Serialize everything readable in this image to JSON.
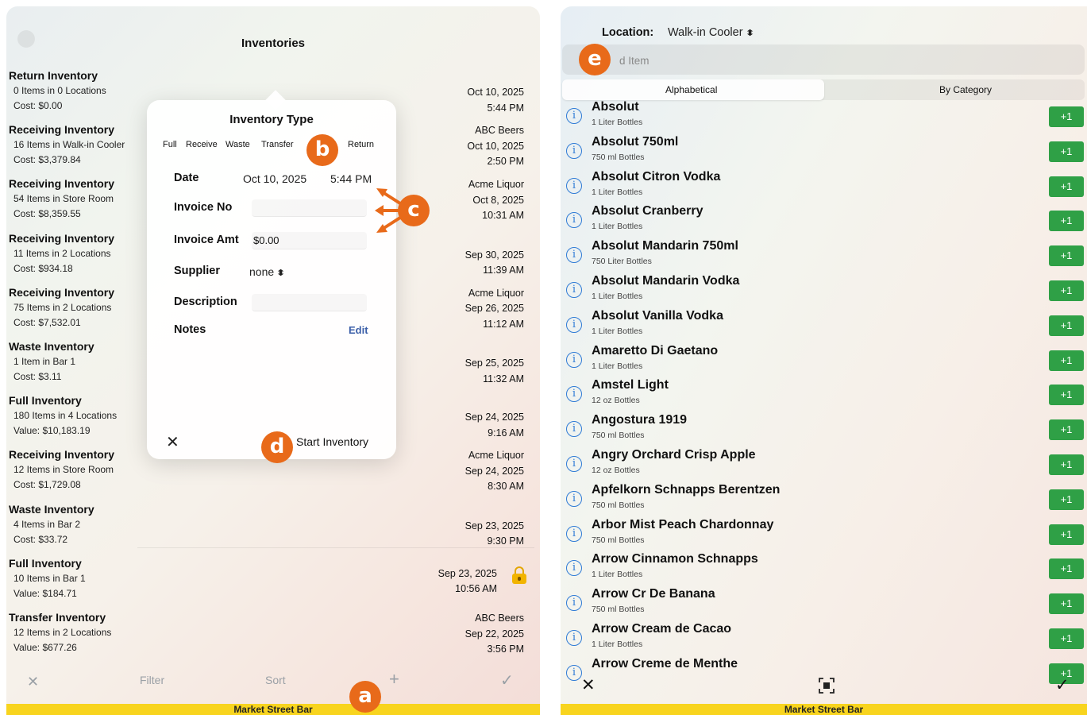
{
  "left_panel": {
    "title": "Inventories",
    "inventories": [
      {
        "title": "Return Inventory",
        "sub": "0 Items in 0 Locations",
        "cost": "Cost: $0.00",
        "right": [
          "Oct 10, 2025",
          "5:44 PM"
        ]
      },
      {
        "title": "Receiving Inventory",
        "sub": "16 Items in Walk-in Cooler",
        "cost": "Cost: $3,379.84",
        "right": [
          "ABC Beers",
          "Oct 10, 2025",
          "2:50 PM"
        ]
      },
      {
        "title": "Receiving Inventory",
        "sub": "54 Items in Store Room",
        "cost": "Cost: $8,359.55",
        "right": [
          "Acme Liquor",
          "Oct 8, 2025",
          "10:31 AM"
        ]
      },
      {
        "title": "Receiving Inventory",
        "sub": "11 Items in 2 Locations",
        "cost": "Cost: $934.18",
        "right": [
          "Sep 30, 2025",
          "11:39 AM"
        ]
      },
      {
        "title": "Receiving Inventory",
        "sub": "75 Items in 2 Locations",
        "cost": "Cost: $7,532.01",
        "right": [
          "Acme Liquor",
          "Sep 26, 2025",
          "11:12 AM"
        ]
      },
      {
        "title": "Waste Inventory",
        "sub": "1 Item in Bar 1",
        "cost": "Cost: $3.11",
        "right": [
          "Sep 25, 2025",
          "11:32 AM"
        ]
      },
      {
        "title": "Full Inventory",
        "sub": "180 Items in 4 Locations",
        "cost": "Value: $10,183.19",
        "right": [
          "Sep 24, 2025",
          "9:16 AM"
        ]
      },
      {
        "title": "Receiving Inventory",
        "sub": "12 Items in Store Room",
        "cost": "Cost: $1,729.08",
        "right": [
          "Acme Liquor",
          "Sep 24, 2025",
          "8:30 AM"
        ]
      },
      {
        "title": "Waste Inventory",
        "sub": "4 Items in Bar 2",
        "cost": "Cost: $33.72",
        "right": [
          "Sep 23, 2025",
          "9:30 PM"
        ]
      },
      {
        "title": "Full Inventory",
        "sub": "10 Items in Bar 1",
        "cost": "Value: $184.71",
        "right": [
          "Sep 23, 2025",
          "10:56 AM"
        ],
        "locked": true
      },
      {
        "title": "Transfer Inventory",
        "sub": "12 Items in 2 Locations",
        "cost": "Value: $677.26",
        "right": [
          "ABC Beers",
          "Sep 22, 2025",
          "3:56 PM"
        ]
      }
    ],
    "toolbar": {
      "filter": "Filter",
      "sort": "Sort",
      "plus": "+",
      "check": "✓",
      "close": "✕"
    },
    "footer": "Market Street Bar"
  },
  "popover": {
    "title": "Inventory Type",
    "segments": [
      "Full",
      "Receive",
      "Waste",
      "Transfer",
      "Return"
    ],
    "date_label": "Date",
    "date_value": "Oct 10, 2025",
    "time_value": "5:44 PM",
    "invoice_no_label": "Invoice No",
    "invoice_no_value": "",
    "invoice_amt_label": "Invoice Amt",
    "invoice_amt_value": "$0.00",
    "supplier_label": "Supplier",
    "supplier_value": "none",
    "description_label": "Description",
    "description_value": "",
    "notes_label": "Notes",
    "edit_label": "Edit",
    "close_glyph": "✕",
    "start_label": "Start Inventory"
  },
  "callouts": {
    "a": "a",
    "b": "b",
    "c": "c",
    "d": "d",
    "e": "e"
  },
  "right_panel": {
    "location_label": "Location:",
    "location_value": "Walk-in Cooler",
    "search_placeholder": "d Item",
    "tabs": [
      "Alphabetical",
      "By Category"
    ],
    "items": [
      {
        "name": "Absolut",
        "sub": "1 Liter Bottles"
      },
      {
        "name": "Absolut 750ml",
        "sub": "750 ml Bottles"
      },
      {
        "name": "Absolut Citron Vodka",
        "sub": "1 Liter Bottles"
      },
      {
        "name": "Absolut Cranberry",
        "sub": "1 Liter Bottles"
      },
      {
        "name": "Absolut Mandarin 750ml",
        "sub": "750 Liter Bottles"
      },
      {
        "name": "Absolut Mandarin Vodka",
        "sub": "1 Liter Bottles"
      },
      {
        "name": "Absolut Vanilla Vodka",
        "sub": "1 Liter Bottles"
      },
      {
        "name": "Amaretto Di Gaetano",
        "sub": "1 Liter Bottles"
      },
      {
        "name": "Amstel Light",
        "sub": "12 oz Bottles"
      },
      {
        "name": "Angostura 1919",
        "sub": "750 ml Bottles"
      },
      {
        "name": "Angry Orchard Crisp Apple",
        "sub": "12 oz Bottles"
      },
      {
        "name": "Apfelkorn Schnapps Berentzen",
        "sub": "750 ml Bottles"
      },
      {
        "name": "Arbor Mist Peach Chardonnay",
        "sub": "750 ml Bottles"
      },
      {
        "name": "Arrow Cinnamon Schnapps",
        "sub": "1 Liter Bottles"
      },
      {
        "name": "Arrow Cr De Banana",
        "sub": "750 ml Bottles"
      },
      {
        "name": "Arrow Cream de Cacao",
        "sub": "1 Liter Bottles"
      },
      {
        "name": "Arrow Creme de Menthe",
        "sub": ""
      }
    ],
    "plus_label": "+1",
    "info_glyph": "i",
    "toolbar": {
      "close": "✕",
      "check": "✓"
    },
    "footer": "Market Street Bar"
  },
  "colors": {
    "accent_orange": "#e86a1a",
    "footer_yellow": "#f8d41e",
    "plus_green": "#2fa046",
    "info_blue": "#2f7bd6"
  }
}
